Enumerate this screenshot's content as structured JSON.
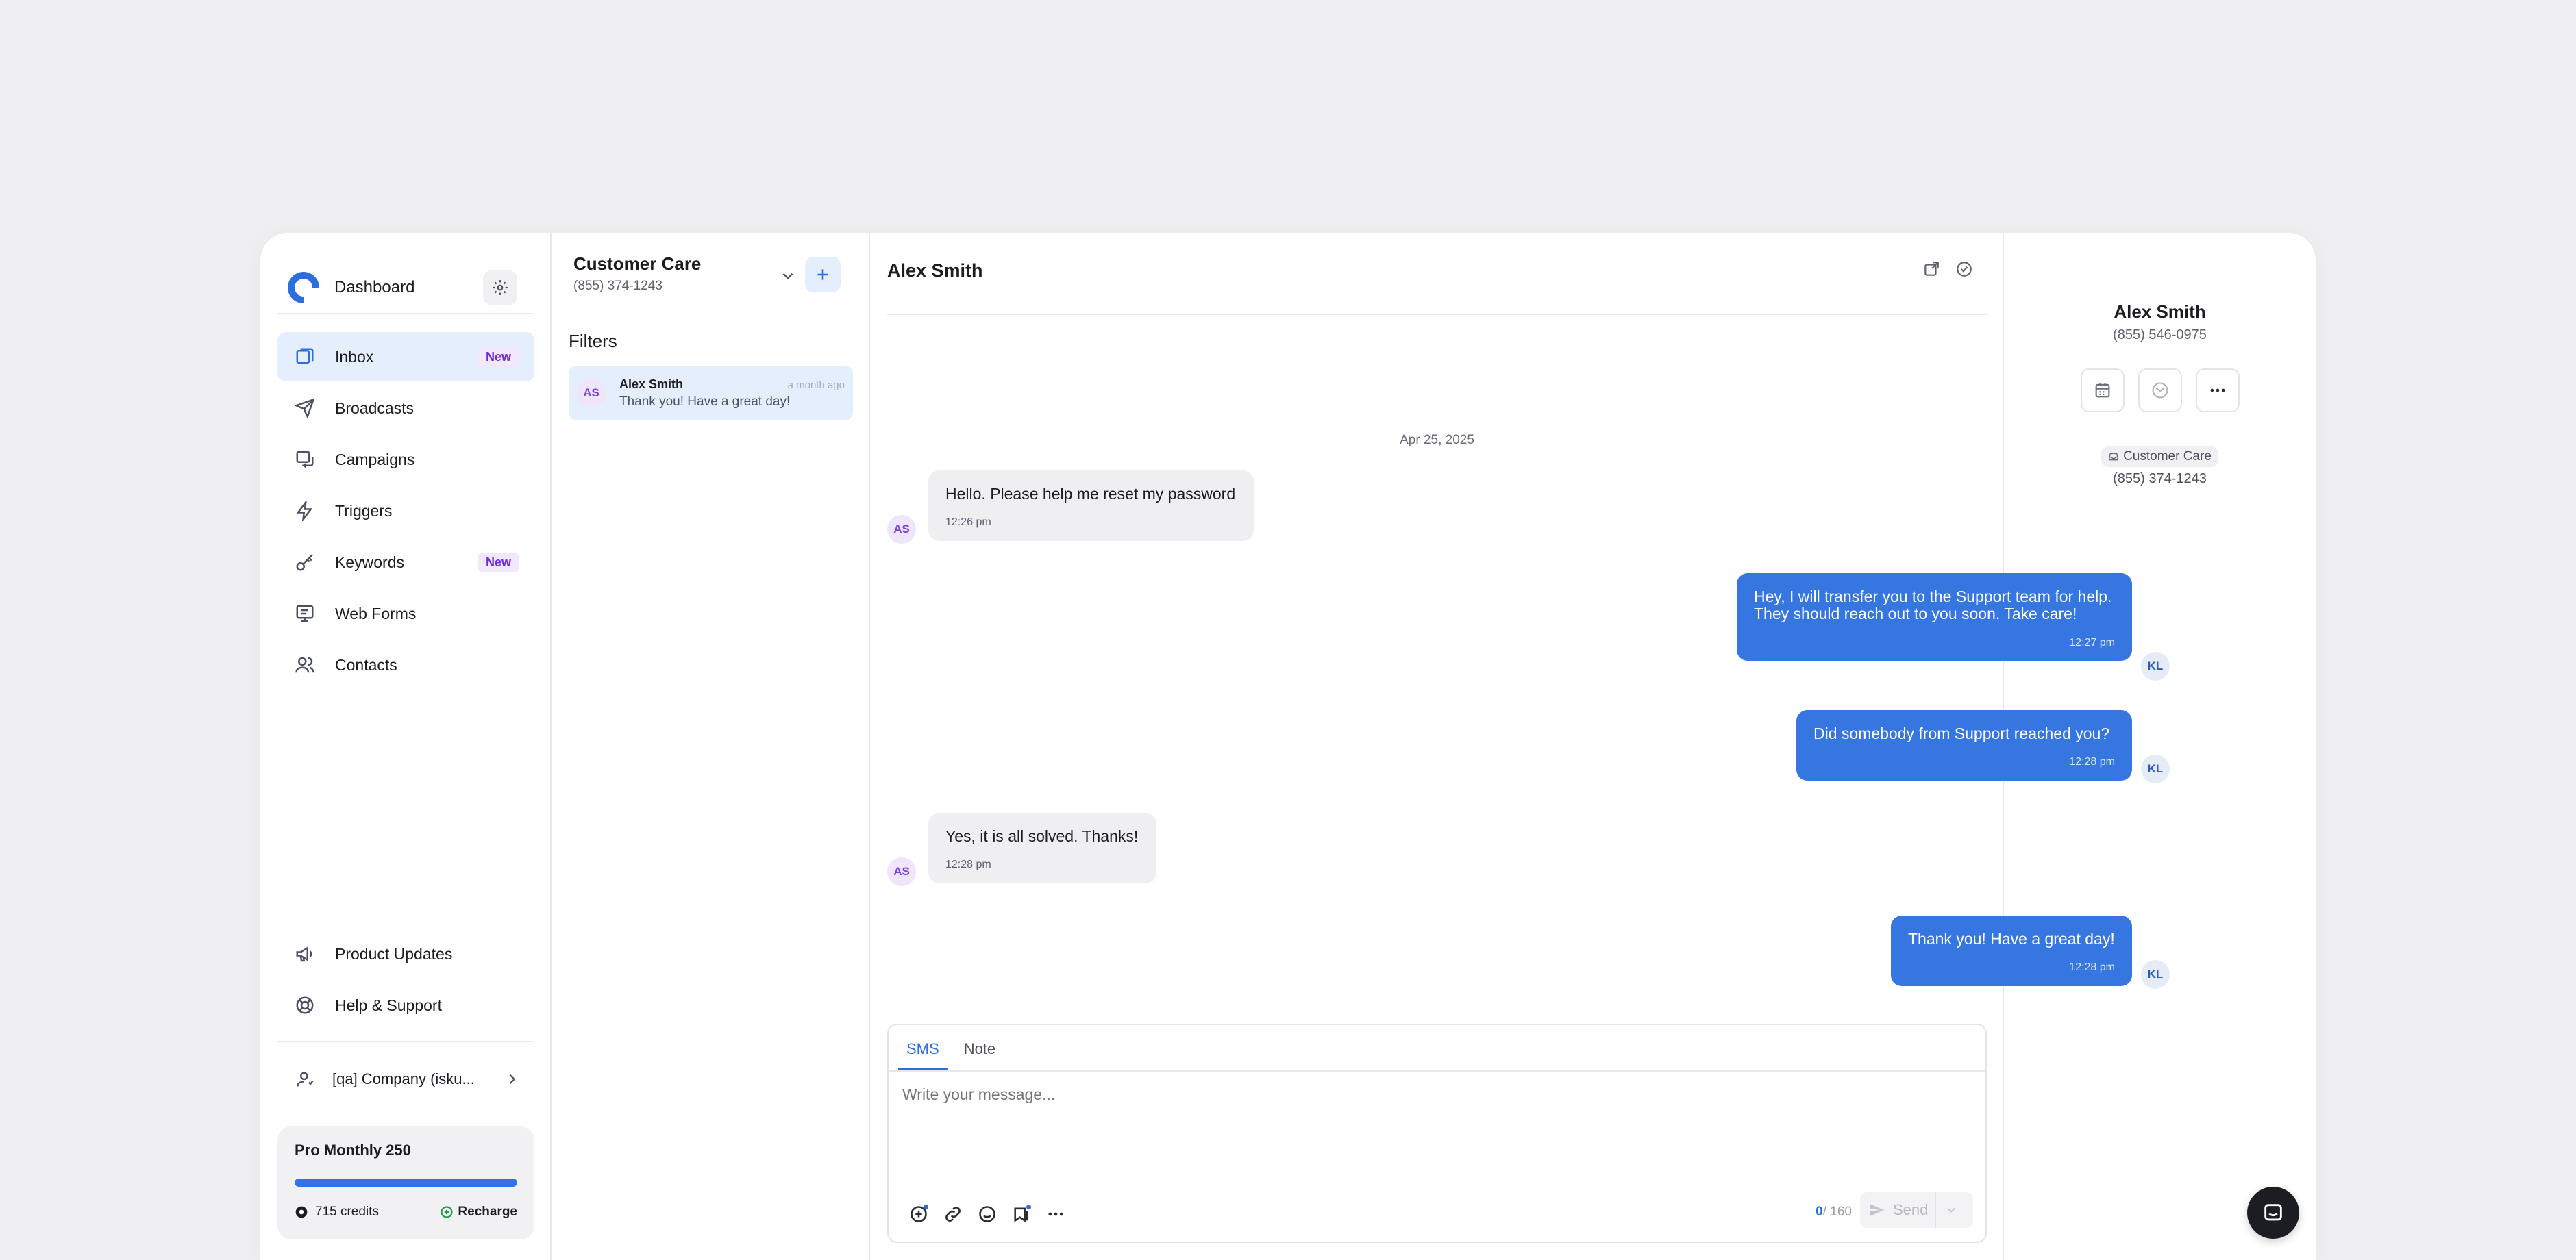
{
  "sidebar": {
    "title": "Dashboard",
    "nav": [
      {
        "label": "Inbox",
        "badge": "New",
        "icon": "inbox-icon"
      },
      {
        "label": "Broadcasts",
        "icon": "send-icon"
      },
      {
        "label": "Campaigns",
        "icon": "campaign-icon"
      },
      {
        "label": "Triggers",
        "icon": "bolt-icon"
      },
      {
        "label": "Keywords",
        "badge": "New",
        "icon": "key-icon"
      },
      {
        "label": "Web Forms",
        "icon": "monitor-icon"
      },
      {
        "label": "Contacts",
        "icon": "users-icon"
      }
    ],
    "bottom_nav": [
      {
        "label": "Product Updates",
        "icon": "megaphone-icon"
      },
      {
        "label": "Help & Support",
        "icon": "lifebuoy-icon"
      }
    ],
    "company": "[qa] Company (isku...",
    "plan": {
      "name": "Pro Monthly 250",
      "credits": "715 credits",
      "recharge": "Recharge",
      "progress": 1.0
    }
  },
  "conversations": {
    "inbox_name": "Customer Care",
    "inbox_phone": "(855) 374-1243",
    "filters_label": "Filters",
    "items": [
      {
        "initials": "AS",
        "name": "Alex Smith",
        "time": "a month ago",
        "preview": "Thank you! Have a great day!"
      }
    ]
  },
  "chat": {
    "title": "Alex Smith",
    "date": "Apr 25, 2025",
    "messages": [
      {
        "dir": "in",
        "initials": "AS",
        "text": "Hello. Please help me reset my password",
        "time": "12:26 pm"
      },
      {
        "dir": "out",
        "initials": "KL",
        "text": "Hey, I will transfer you to the Support team for help. They should reach out to you soon. Take care!",
        "time": "12:27 pm"
      },
      {
        "dir": "out",
        "initials": "KL",
        "text": "Did somebody from Support reached you?",
        "time": "12:28 pm"
      },
      {
        "dir": "in",
        "initials": "AS",
        "text": "Yes, it is all solved. Thanks!",
        "time": "12:28 pm"
      },
      {
        "dir": "out",
        "initials": "KL",
        "text": "Thank you! Have a great day!",
        "time": "12:28 pm"
      }
    ],
    "composer": {
      "tabs": [
        "SMS",
        "Note"
      ],
      "placeholder": "Write your message...",
      "count": "0",
      "limit": "/ 160",
      "send_label": "Send"
    }
  },
  "contact": {
    "name": "Alex Smith",
    "phone": "(855) 546-0975",
    "inbox_chip": "Customer Care",
    "inbox_phone": "(855) 374-1243"
  },
  "colors": {
    "accent": "#2c6ee0",
    "outgoing_bubble": "#3576e0",
    "incoming_bubble": "#efeff2",
    "badge_purple": "#6d2bd9"
  }
}
